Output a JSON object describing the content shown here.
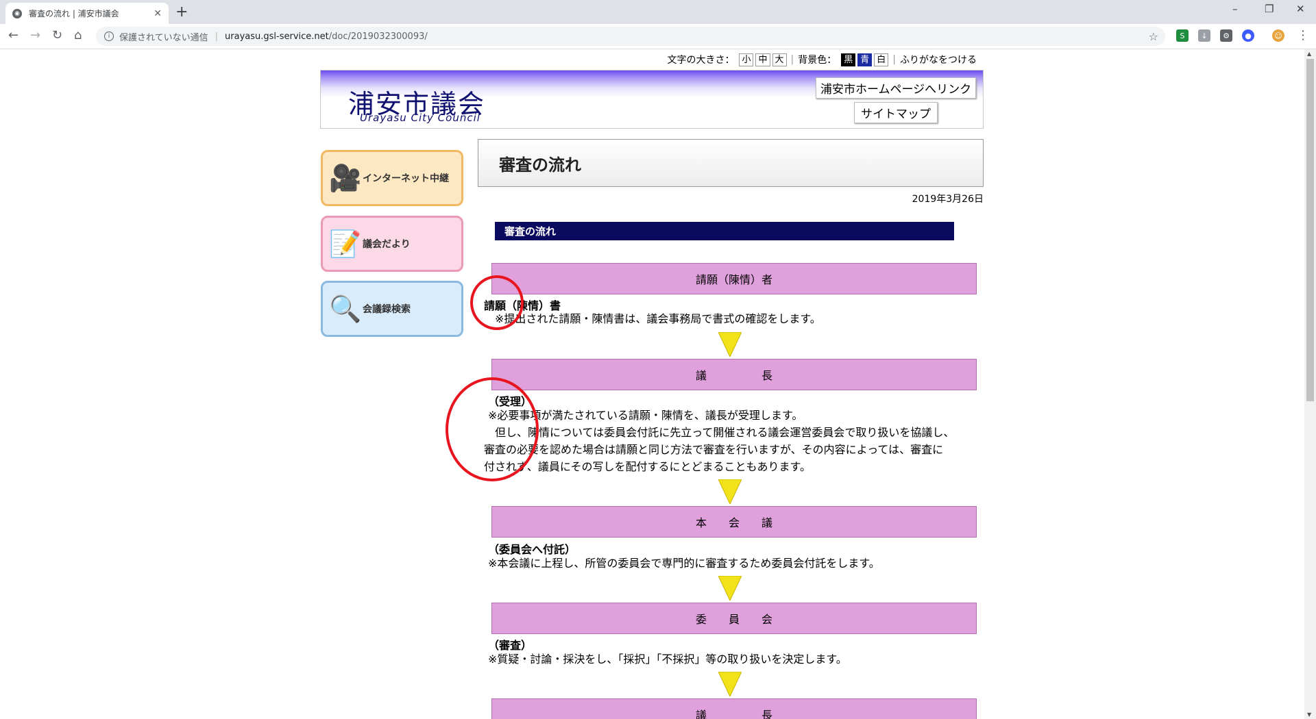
{
  "browser": {
    "tab_title": "審査の流れ | 浦安市議会",
    "tab_close": "✕",
    "new_tab": "+",
    "window_controls": [
      "–",
      "❐",
      "✕"
    ],
    "nav": {
      "back": "←",
      "forward": "→",
      "reload": "↻",
      "home": "⌂"
    },
    "security_text": "保護されていない通信",
    "url_host": "urayasu.gsl-service.net",
    "url_path": "/doc/2019032300093/",
    "bookmark": "☆",
    "menu": "⋮"
  },
  "utility": {
    "font_size_label": "文字の大きさ：",
    "font_sizes": [
      "小",
      "中",
      "大"
    ],
    "bg_color_label": "背景色：",
    "bg_colors": [
      "黒",
      "青",
      "白"
    ],
    "furigana": "ふりがなをつける"
  },
  "header": {
    "logo_jp": "浦安市議会",
    "logo_en": "Urayasu City Council",
    "homepage_link": "浦安市ホームページへリンク",
    "sitemap": "サイトマップ"
  },
  "sidebar": [
    {
      "label": "インターネット中継",
      "icon": "video-camera-icon",
      "glyph": "🎥",
      "border": "#f0b860",
      "bg": "#fde8c4"
    },
    {
      "label": "議会だより",
      "icon": "notepad-icon",
      "glyph": "📝",
      "border": "#ea9ab8",
      "bg": "#fbd9e6"
    },
    {
      "label": "会議録検索",
      "icon": "magnifier-icon",
      "glyph": "🔍",
      "border": "#8ab8e0",
      "bg": "#d9ecfb"
    }
  ],
  "content": {
    "title": "審査の流れ",
    "date": "2019年3月26日",
    "section_heading": "審査の流れ",
    "steps": [
      {
        "label": "請願（陳情）者"
      },
      {
        "label": "議　　　　　長"
      },
      {
        "label": "本　　会　　議"
      },
      {
        "label": "委　　員　　会"
      },
      {
        "label": "議　　　　　長"
      }
    ],
    "desc1": {
      "title": "請願（陳情）書",
      "lines": [
        "※提出された請願・陳情書は、議会事務局で書式の確認をします。"
      ]
    },
    "desc2": {
      "title": "（受理）",
      "lines": [
        "※必要事項が満たされている請願・陳情を、議長が受理します。",
        "　但し、陳情については委員会付託に先立って開催される議会運営委員会で取り扱いを協議し、",
        "審査の必要を認めた場合は請願と同じ方法で審査を行いますが、その内容によっては、審査に",
        "付されず、議員にその写しを配付するにとどまることもあります。"
      ]
    },
    "desc3": {
      "title": "（委員会へ付託）",
      "lines": [
        "※本会議に上程し、所管の委員会で専門的に審査するため委員会付託をします。"
      ]
    },
    "desc4": {
      "title": "（審査）",
      "lines": [
        "※質疑・討論・採決をし、「採択」「不採択」等の取り扱いを決定します。"
      ]
    }
  },
  "colors": {
    "step_fill": "#dfa0dc",
    "section_bar": "#0a0a5e",
    "arrow": "#f2e21a",
    "annotation": "#e8141e"
  }
}
